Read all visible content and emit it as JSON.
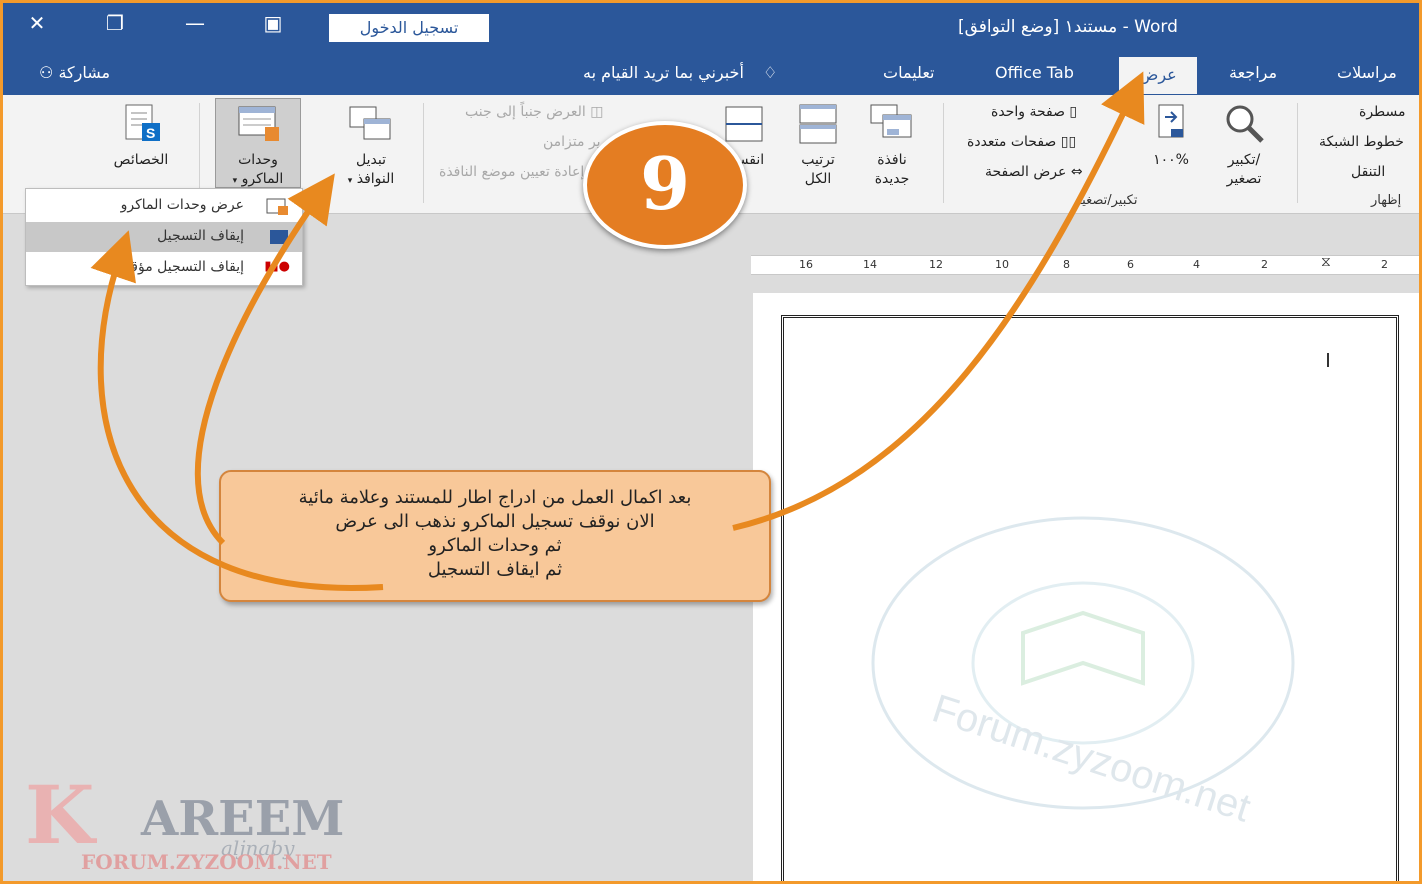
{
  "window": {
    "title": "مستند١ [وضع التوافق]",
    "app_name": "Word",
    "separator": "-",
    "signin_label": "تسجيل الدخول"
  },
  "tabs": {
    "view": "عرض",
    "review": "مراجعة",
    "mailings": "مراسلات",
    "office_tab": "Office Tab",
    "help": "تعليمات",
    "tell_me": "أخبرني بما تريد القيام به",
    "share": "مشاركة"
  },
  "ribbon": {
    "properties": "الخصائص",
    "macros_line1": "وحدات",
    "macros_line2": "الماكرو",
    "switch_line1": "تبديل",
    "switch_line2": "النوافذ",
    "view_side_by_side": "العرض جنباً إلى جنب",
    "sync_scroll": "تمرير متزامن",
    "reset_position": "إعادة تعيين موضع النافذة",
    "split": "انقسام",
    "arrange_line1": "ترتيب",
    "arrange_line2": "الكل",
    "new_window_line1": "نافذة",
    "new_window_line2": "جديدة",
    "one_page": "صفحة واحدة",
    "multiple_pages": "صفحات متعددة",
    "page_width": "عرض الصفحة",
    "zoom_100": "١٠٠%",
    "zoom_line1": "تكبير/",
    "zoom_line2": "تصغير",
    "zoom_group": "تكبير/تصغير",
    "ruler": "مسطرة",
    "gridlines": "خطوط الشبكة",
    "nav_pane": "التنقل",
    "show_group": "إظهار"
  },
  "macro_menu": {
    "view_macros": "عرض وحدات الماكرو",
    "stop_recording": "إيقاف التسجيل",
    "pause_recording": "إيقاف التسجيل مؤقتاً"
  },
  "ruler_ticks": [
    "16",
    "14",
    "12",
    "10",
    "8",
    "6",
    "4",
    "2",
    "2"
  ],
  "step_number": "9",
  "callout": {
    "line1": "بعد اكمال العمل من ادراج اطار للمستند وعلامة مائية",
    "line2": "الان نوقف تسجيل الماكرو نذهب الى عرض",
    "line3": "ثم وحدات الماكرو",
    "line4": "ثم ايقاف التسجيل"
  },
  "watermark_text": "Forum.zyzoom.net",
  "logo": {
    "brand": "AREEM",
    "initial": "K",
    "script": "aljnaby",
    "site": "FORUM.ZYZOOM.NET"
  },
  "colors": {
    "word_blue": "#2b579a",
    "accent_orange": "#e47d22",
    "callout_fill": "#f8c899",
    "frame_border": "#f39a2b"
  }
}
